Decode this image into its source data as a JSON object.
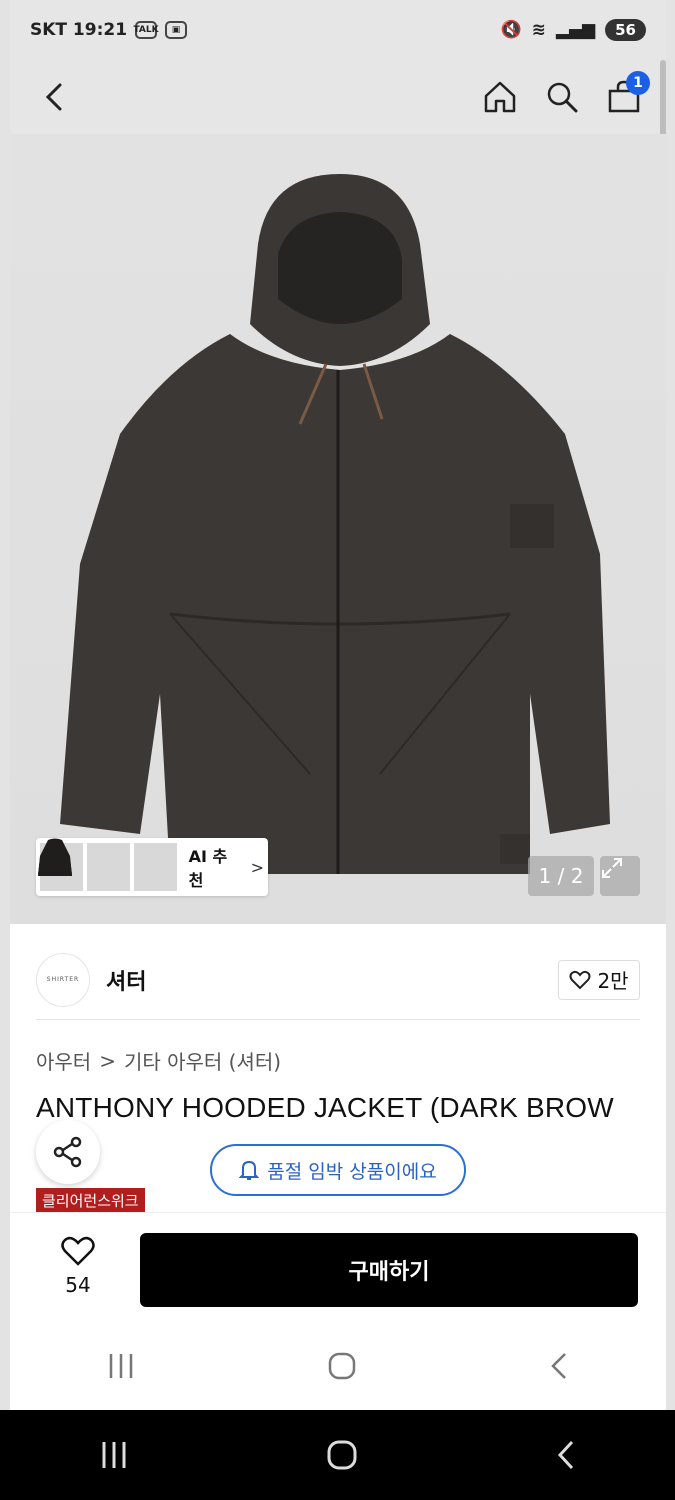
{
  "status_bar": {
    "left_text": "SKT 19:21",
    "talk_badge": "TALK",
    "battery": "56"
  },
  "header": {
    "icons": [
      "back-arrow-icon",
      "home-icon",
      "search-icon",
      "cart-icon"
    ],
    "cart_count": "1"
  },
  "gallery": {
    "counter": "1 / 2",
    "ai_recommend_label": "AI 추천",
    "thumb_count": 3
  },
  "brand": {
    "logo_text": "SHIRTER",
    "name": "셔터",
    "like_count": "2만"
  },
  "product": {
    "breadcrumb": [
      "아우터",
      "기타 아우터 (셔터)"
    ],
    "title": "ANTHONY HOODED JACKET (DARK BROW",
    "soldout_notice": "품절 임박 상품이에요",
    "promo_tag": "클리어런스위크"
  },
  "action_bar": {
    "wish_count": "54",
    "buy_label": "구매하기"
  },
  "colors": {
    "accent_blue": "#1b5fe6",
    "promo_red": "#b01e1e",
    "buy_black": "#000000"
  }
}
